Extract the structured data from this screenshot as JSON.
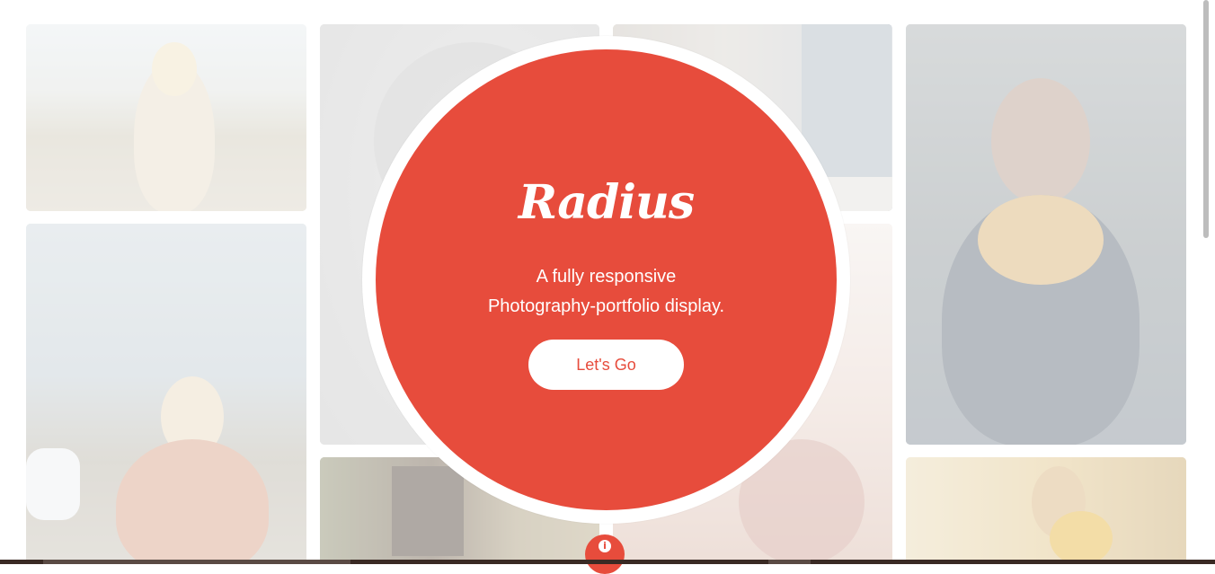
{
  "hero": {
    "brand": "Radius",
    "tagline_line1": "A fully responsive",
    "tagline_line2": "Photography-portfolio display.",
    "cta_label": "Let's Go"
  },
  "info_icon_glyph": "i",
  "colors": {
    "accent": "#e74c3c",
    "background": "#ffffff",
    "bottom_bar": "#3a2a24"
  },
  "gallery": {
    "tiles": [
      {
        "subject": "blonde woman outdoors"
      },
      {
        "subject": "grey archway"
      },
      {
        "subject": "window"
      },
      {
        "subject": "woman smelling flowers"
      },
      {
        "subject": "blonde woman near car"
      },
      {
        "subject": "graffiti wall"
      },
      {
        "subject": "warm bokeh portrait"
      },
      {
        "subject": "woman with sunflower"
      }
    ]
  },
  "icons": [
    "info-icon"
  ]
}
